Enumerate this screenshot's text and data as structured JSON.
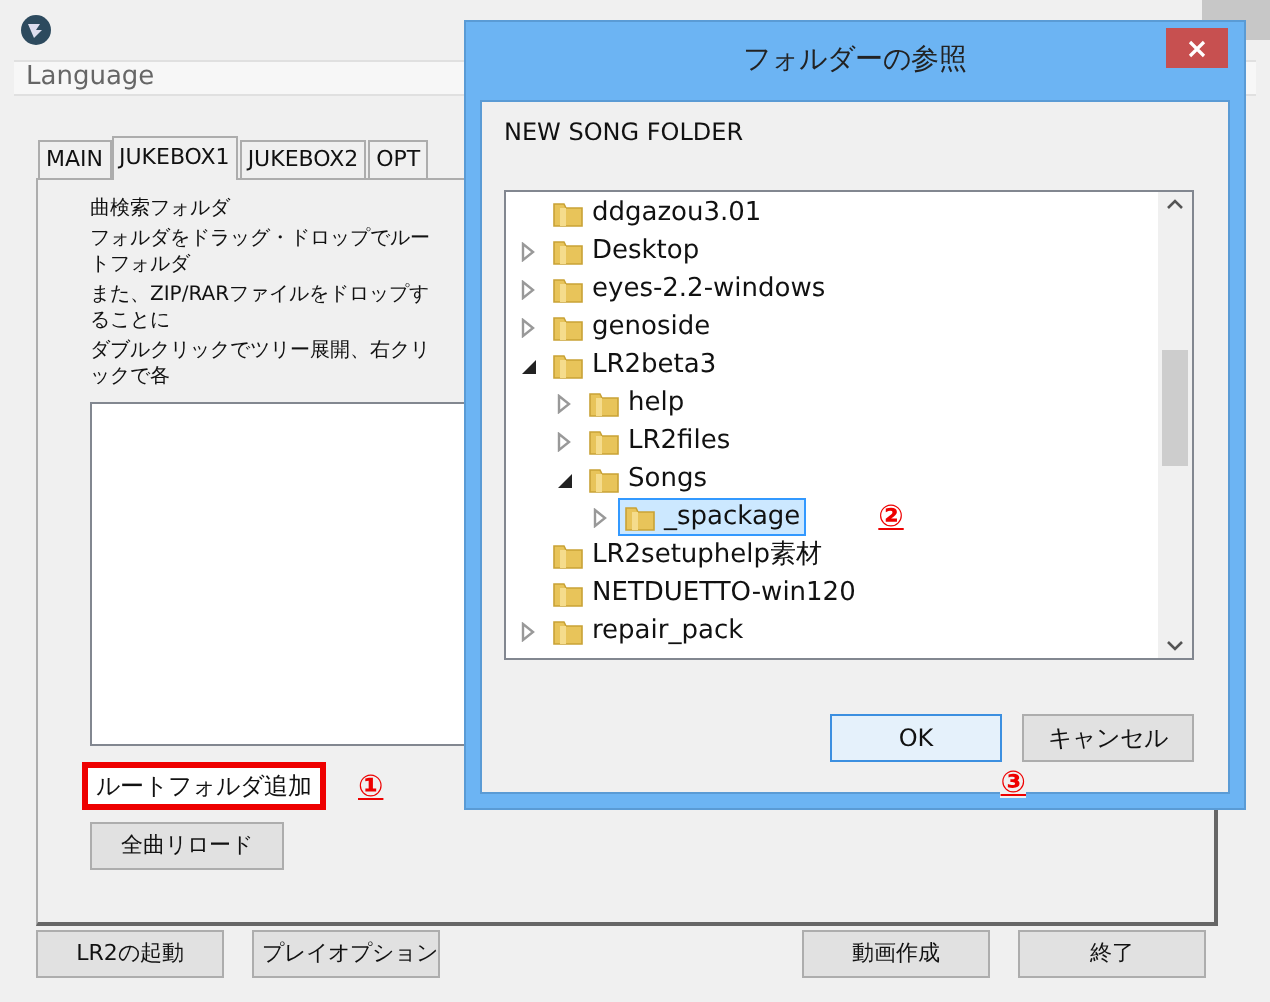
{
  "menu": {
    "items": [
      "Language"
    ]
  },
  "tabs": [
    {
      "label": "MAIN",
      "selected": false
    },
    {
      "label": "JUKEBOX1",
      "selected": true
    },
    {
      "label": "JUKEBOX2",
      "selected": false
    },
    {
      "label": "OPT",
      "selected": false
    }
  ],
  "panel": {
    "heading": "曲検索フォルダ",
    "lines": [
      "フォルダをドラッグ・ドロップでルートフォルダ",
      "また、ZIP/RARファイルをドロップすることに",
      "ダブルクリックでツリー展開、右クリックで各"
    ],
    "buttons": [
      {
        "label": "ルートフォルダ追加",
        "highlighted": true,
        "annotation": "①"
      },
      {
        "label": "全曲リロード",
        "highlighted": false
      }
    ]
  },
  "footer_buttons": [
    "LR2の起動",
    "プレイオプション",
    "動画作成",
    "終了"
  ],
  "dialog": {
    "title": "フォルダーの参照",
    "description": "NEW SONG FOLDER",
    "tree": [
      {
        "label": "ddgazou3.01",
        "expandable": false,
        "selected": false
      },
      {
        "label": "Desktop",
        "expandable": true,
        "expanded": false,
        "selected": false
      },
      {
        "label": "eyes-2.2-windows",
        "expandable": true,
        "expanded": false,
        "selected": false
      },
      {
        "label": "genoside",
        "expandable": true,
        "expanded": false,
        "selected": false
      },
      {
        "label": "LR2beta3",
        "expandable": true,
        "expanded": true,
        "selected": false,
        "children": [
          {
            "label": "help",
            "expandable": true,
            "expanded": false,
            "selected": false
          },
          {
            "label": "LR2files",
            "expandable": true,
            "expanded": false,
            "selected": false
          },
          {
            "label": "Songs",
            "expandable": true,
            "expanded": true,
            "selected": false,
            "children": [
              {
                "label": "_spackage",
                "expandable": true,
                "expanded": false,
                "selected": true,
                "annotation": "②"
              }
            ]
          }
        ]
      },
      {
        "label": "LR2setuphelp素材",
        "expandable": false,
        "selected": false
      },
      {
        "label": "NETDUETTO-win120",
        "expandable": false,
        "selected": false
      },
      {
        "label": "repair_pack",
        "expandable": true,
        "expanded": false,
        "selected": false
      }
    ],
    "buttons": [
      {
        "label": "OK",
        "default": true,
        "annotation": "③"
      },
      {
        "label": "キャンセル",
        "default": false
      }
    ]
  }
}
